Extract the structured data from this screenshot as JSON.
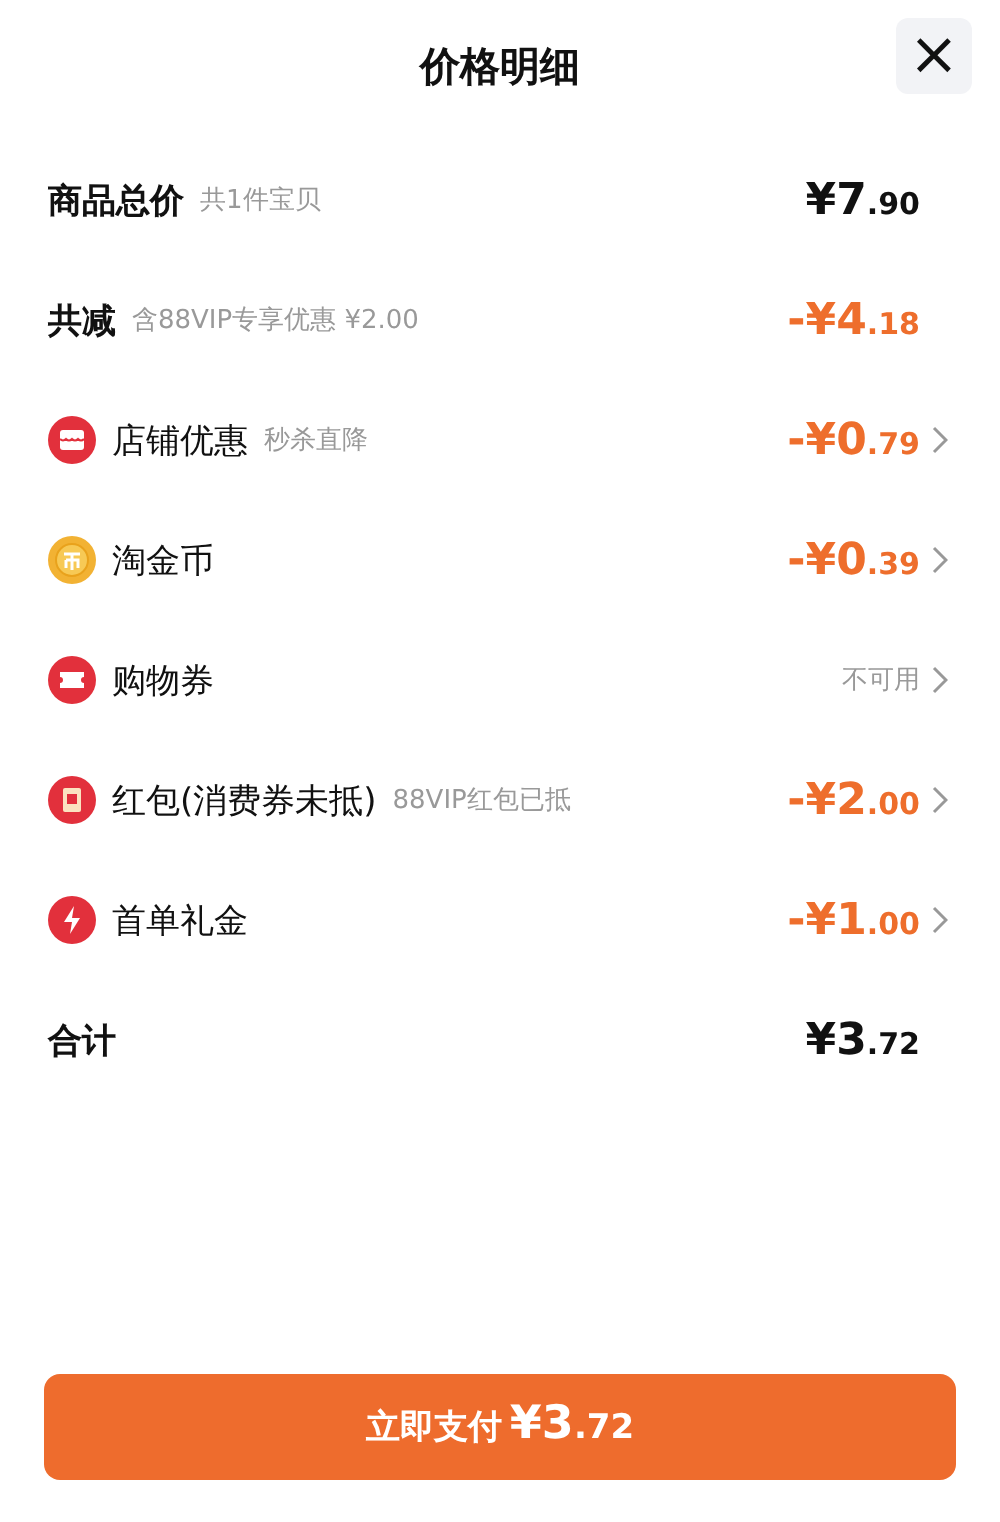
{
  "header": {
    "title": "价格明细",
    "close": "×"
  },
  "rows": [
    {
      "kind": "summary",
      "label": "商品总价",
      "note": "共1件宝贝",
      "amount": {
        "whole": "¥7",
        "decimal": ".90"
      },
      "deduction": false
    },
    {
      "kind": "summary",
      "label": "共减",
      "note": "含88VIP专享优惠 ¥2.00",
      "amount": {
        "whole": "-¥4",
        "decimal": ".18"
      },
      "deduction": true
    },
    {
      "kind": "store",
      "label": "店铺优惠",
      "note": "秒杀直降",
      "amount": {
        "whole": "-¥0",
        "decimal": ".79"
      },
      "deduction": true,
      "arrow": true
    },
    {
      "kind": "coin",
      "label": "淘金币",
      "amount": {
        "whole": "-¥0",
        "decimal": ".39"
      },
      "deduction": true,
      "arrow": true
    },
    {
      "kind": "coupon",
      "label": "购物券",
      "status": "不可用",
      "arrow": true
    },
    {
      "kind": "packet",
      "label": "红包(消费券未抵)",
      "note": "88VIP红包已抵",
      "amount": {
        "whole": "-¥2",
        "decimal": ".00"
      },
      "deduction": true,
      "arrow": true
    },
    {
      "kind": "bolt",
      "label": "首单礼金",
      "amount": {
        "whole": "-¥1",
        "decimal": ".00"
      },
      "deduction": true,
      "arrow": true
    },
    {
      "kind": "summary",
      "label": "合计",
      "amount": {
        "whole": "¥3",
        "decimal": ".72"
      },
      "deduction": false
    }
  ],
  "pay_button": {
    "label": "立即支付",
    "amount": {
      "whole": "¥3",
      "decimal": ".72"
    }
  }
}
